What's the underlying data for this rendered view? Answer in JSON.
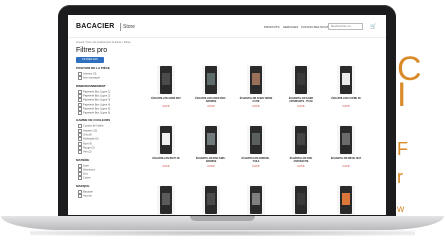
{
  "right_panel": {
    "line1": "C",
    "line2": "I",
    "line3": "F",
    "line4": "r",
    "line5": "w"
  },
  "site": {
    "logo_text": "BACACIER",
    "logo_sub": "Store",
    "nav": [
      "PRODUITS",
      "SERVICES",
      "CONTACTEZ-NOUS"
    ],
    "search_placeholder": "Rechercher un...",
    "breadcrumb": "Accueil / Tous nos produits pour la toiture / Filtres",
    "page_title": "Filtres pro",
    "filter_button": "FILTRER LES PRODUITS"
  },
  "filters": [
    {
      "heading": "POSITION DE LA PIÈCE",
      "items": [
        "Intérieur (3)",
        "Non renseigné"
      ]
    },
    {
      "heading": "DIMENSIONNEMENT",
      "items": [
        "Papeterie Box (Ligne 1)",
        "Papeterie Box (Ligne 2)",
        "Papeterie Box (Ligne 3)",
        "Papeterie Box (Ligne 4)",
        "Papeterie Box (Ligne 5)",
        "Papeterie Box (Ligne 6)"
      ]
    },
    {
      "heading": "GAMME DE COULEURS",
      "items": [
        "Couleur de l'arbre",
        "Ardoise (12)",
        "Gris (8)",
        "Anthracite (6)",
        "Noir (4)",
        "Rouge (3)",
        "Vert (2)"
      ]
    },
    {
      "heading": "MATIÈRE",
      "items": [
        "Acier",
        "Aluminium",
        "Zinc",
        "Cuivre"
      ]
    },
    {
      "heading": "MARQUE",
      "items": [
        "Bacacier",
        "Aucune"
      ]
    }
  ],
  "products": [
    {
      "name": "ÉCHANTILLON ACIER MAT",
      "price": "0,00 €",
      "bag_color": "#2a2a2a",
      "win_color": "#4b4b4b"
    },
    {
      "name": "ÉCHANTILLON ACIER ZINC - ARDOISE",
      "price": "0,00 €",
      "bag_color": "#2a2a2a",
      "win_color": "#5c6a6a"
    },
    {
      "name": "ÉCHANTILLON ACIER TERRE CUITE",
      "price": "0,00 €",
      "bag_color": "#2a2a2a",
      "win_color": "#9a7158"
    },
    {
      "name": "ÉCHANTILLON ACIER ANTHRACITE - TUILE",
      "price": "0,00 €",
      "bag_color": "#2a2a2a",
      "win_color": "#3a3a3a"
    },
    {
      "name": "ÉCHANTILLON CUIVRE 3D",
      "price": "0,00 €",
      "bag_color": "#2a2a2a",
      "win_color": "#eaeaea"
    },
    {
      "name": "ÉCHANTILLON BRUT 3D",
      "price": "0,00 €",
      "bag_color": "#2a2a2a",
      "win_color": "#f0f0f0"
    },
    {
      "name": "ÉCHANTILLON ZINC GRIS - ARDOISE",
      "price": "0,00 €",
      "bag_color": "#2a2a2a",
      "win_color": "#707a7a"
    },
    {
      "name": "ÉCHANTILLON ARDOISE - TUILE",
      "price": "0,00 €",
      "bag_color": "#2a2a2a",
      "win_color": "#5a5f5f"
    },
    {
      "name": "ÉCHANTILLON ZINC ANTHRACITE",
      "price": "0,00 €",
      "bag_color": "#2a2a2a",
      "win_color": "#454545"
    },
    {
      "name": "ÉCHANTILLON METAL MAT",
      "price": "0,00 €",
      "bag_color": "#2a2a2a",
      "win_color": "#6b6b6b"
    },
    {
      "name": "",
      "price": "",
      "bag_color": "#2a2a2a",
      "win_color": "#5a5a5a"
    },
    {
      "name": "",
      "price": "",
      "bag_color": "#2a2a2a",
      "win_color": "#4a4a4a"
    },
    {
      "name": "",
      "price": "",
      "bag_color": "#2a2a2a",
      "win_color": "#808080"
    },
    {
      "name": "",
      "price": "",
      "bag_color": "#2a2a2a",
      "win_color": "#3a3a3a"
    },
    {
      "name": "",
      "price": "",
      "bag_color": "#2a2a2a",
      "win_color": "#d9783a"
    }
  ]
}
